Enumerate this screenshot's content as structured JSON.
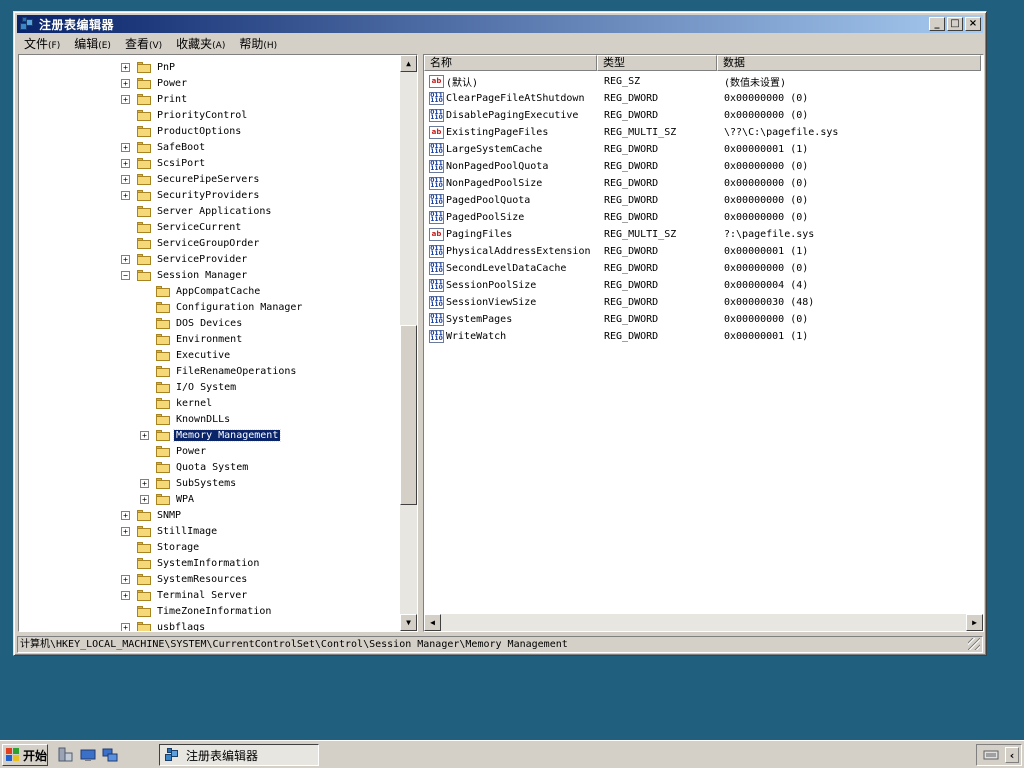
{
  "window": {
    "title": "注册表编辑器",
    "minimize_label": "_",
    "maximize_label": "□",
    "close_label": "×"
  },
  "menu": [
    {
      "label": "文件",
      "accel": "(F)"
    },
    {
      "label": "编辑",
      "accel": "(E)"
    },
    {
      "label": "查看",
      "accel": "(V)"
    },
    {
      "label": "收藏夹",
      "accel": "(A)"
    },
    {
      "label": "帮助",
      "accel": "(H)"
    }
  ],
  "tree": {
    "items": [
      {
        "label": "PnP",
        "level": 0,
        "expander": "+"
      },
      {
        "label": "Power",
        "level": 0,
        "expander": "+"
      },
      {
        "label": "Print",
        "level": 0,
        "expander": "+"
      },
      {
        "label": "PriorityControl",
        "level": 0,
        "expander": ""
      },
      {
        "label": "ProductOptions",
        "level": 0,
        "expander": ""
      },
      {
        "label": "SafeBoot",
        "level": 0,
        "expander": "+"
      },
      {
        "label": "ScsiPort",
        "level": 0,
        "expander": "+"
      },
      {
        "label": "SecurePipeServers",
        "level": 0,
        "expander": "+"
      },
      {
        "label": "SecurityProviders",
        "level": 0,
        "expander": "+"
      },
      {
        "label": "Server Applications",
        "level": 0,
        "expander": ""
      },
      {
        "label": "ServiceCurrent",
        "level": 0,
        "expander": ""
      },
      {
        "label": "ServiceGroupOrder",
        "level": 0,
        "expander": ""
      },
      {
        "label": "ServiceProvider",
        "level": 0,
        "expander": "+"
      },
      {
        "label": "Session Manager",
        "level": 0,
        "expander": "-"
      },
      {
        "label": "AppCompatCache",
        "level": 1,
        "expander": ""
      },
      {
        "label": "Configuration Manager",
        "level": 1,
        "expander": ""
      },
      {
        "label": "DOS Devices",
        "level": 1,
        "expander": ""
      },
      {
        "label": "Environment",
        "level": 1,
        "expander": ""
      },
      {
        "label": "Executive",
        "level": 1,
        "expander": ""
      },
      {
        "label": "FileRenameOperations",
        "level": 1,
        "expander": ""
      },
      {
        "label": "I/O System",
        "level": 1,
        "expander": ""
      },
      {
        "label": "kernel",
        "level": 1,
        "expander": ""
      },
      {
        "label": "KnownDLLs",
        "level": 1,
        "expander": ""
      },
      {
        "label": "Memory Management",
        "level": 1,
        "expander": "+",
        "selected": true
      },
      {
        "label": "Power",
        "level": 1,
        "expander": ""
      },
      {
        "label": "Quota System",
        "level": 1,
        "expander": ""
      },
      {
        "label": "SubSystems",
        "level": 1,
        "expander": "+"
      },
      {
        "label": "WPA",
        "level": 1,
        "expander": "+"
      },
      {
        "label": "SNMP",
        "level": 0,
        "expander": "+"
      },
      {
        "label": "StillImage",
        "level": 0,
        "expander": "+"
      },
      {
        "label": "Storage",
        "level": 0,
        "expander": ""
      },
      {
        "label": "SystemInformation",
        "level": 0,
        "expander": ""
      },
      {
        "label": "SystemResources",
        "level": 0,
        "expander": "+"
      },
      {
        "label": "Terminal Server",
        "level": 0,
        "expander": "+"
      },
      {
        "label": "TimeZoneInformation",
        "level": 0,
        "expander": ""
      },
      {
        "label": "usbflags",
        "level": 0,
        "expander": "+"
      }
    ]
  },
  "values": {
    "columns": [
      "名称",
      "类型",
      "数据"
    ],
    "rows": [
      {
        "icon": "ab",
        "name": "(默认)",
        "type": "REG_SZ",
        "data": "(数值未设置)"
      },
      {
        "icon": "bin",
        "name": "ClearPageFileAtShutdown",
        "type": "REG_DWORD",
        "data": "0x00000000 (0)"
      },
      {
        "icon": "bin",
        "name": "DisablePagingExecutive",
        "type": "REG_DWORD",
        "data": "0x00000000 (0)"
      },
      {
        "icon": "ab",
        "name": "ExistingPageFiles",
        "type": "REG_MULTI_SZ",
        "data": "\\??\\C:\\pagefile.sys"
      },
      {
        "icon": "bin",
        "name": "LargeSystemCache",
        "type": "REG_DWORD",
        "data": "0x00000001 (1)"
      },
      {
        "icon": "bin",
        "name": "NonPagedPoolQuota",
        "type": "REG_DWORD",
        "data": "0x00000000 (0)"
      },
      {
        "icon": "bin",
        "name": "NonPagedPoolSize",
        "type": "REG_DWORD",
        "data": "0x00000000 (0)"
      },
      {
        "icon": "bin",
        "name": "PagedPoolQuota",
        "type": "REG_DWORD",
        "data": "0x00000000 (0)"
      },
      {
        "icon": "bin",
        "name": "PagedPoolSize",
        "type": "REG_DWORD",
        "data": "0x00000000 (0)"
      },
      {
        "icon": "ab",
        "name": "PagingFiles",
        "type": "REG_MULTI_SZ",
        "data": "?:\\pagefile.sys"
      },
      {
        "icon": "bin",
        "name": "PhysicalAddressExtension",
        "type": "REG_DWORD",
        "data": "0x00000001 (1)"
      },
      {
        "icon": "bin",
        "name": "SecondLevelDataCache",
        "type": "REG_DWORD",
        "data": "0x00000000 (0)"
      },
      {
        "icon": "bin",
        "name": "SessionPoolSize",
        "type": "REG_DWORD",
        "data": "0x00000004 (4)"
      },
      {
        "icon": "bin",
        "name": "SessionViewSize",
        "type": "REG_DWORD",
        "data": "0x00000030 (48)"
      },
      {
        "icon": "bin",
        "name": "SystemPages",
        "type": "REG_DWORD",
        "data": "0x00000000 (0)"
      },
      {
        "icon": "bin",
        "name": "WriteWatch",
        "type": "REG_DWORD",
        "data": "0x00000001 (1)"
      }
    ]
  },
  "status": {
    "path": "计算机\\HKEY_LOCAL_MACHINE\\SYSTEM\\CurrentControlSet\\Control\\Session Manager\\Memory Management"
  },
  "taskbar": {
    "start_label": "开始",
    "task_label": "注册表编辑器",
    "tray_chevron": "‹"
  },
  "icons": {
    "string_value": "ab",
    "binary_value": "011 110",
    "folder": "folder-icon"
  }
}
